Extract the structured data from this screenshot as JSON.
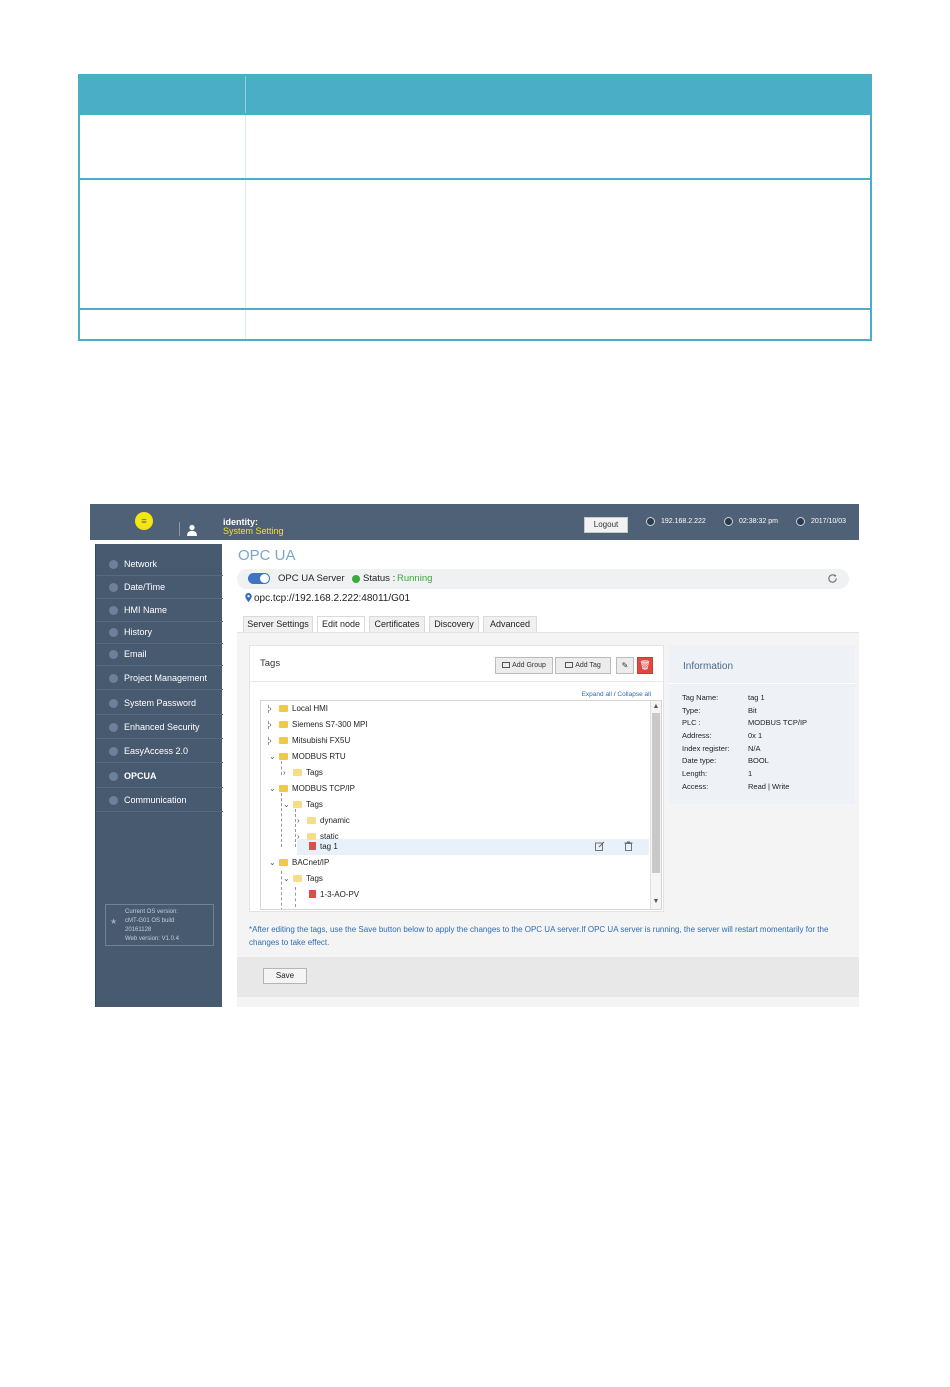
{
  "topbar": {
    "menu_icon": "menu-icon",
    "user_icon": "user-icon",
    "identity_label": "identity:",
    "role": "System Setting",
    "logout_label": "Logout",
    "ip": "192.168.2.222",
    "time": "02:38:32 pm",
    "date": "2017/10/03"
  },
  "sidebar": {
    "items": [
      {
        "label": "Network",
        "icon": "network-icon"
      },
      {
        "label": "Date/Time",
        "icon": "clock-icon"
      },
      {
        "label": "HMI Name",
        "icon": "pencil-icon"
      },
      {
        "label": "History",
        "icon": "history-icon"
      },
      {
        "label": "Email",
        "icon": "email-icon"
      },
      {
        "label": "Project Management",
        "icon": "project-icon"
      },
      {
        "label": "System Password",
        "icon": "lock-icon"
      },
      {
        "label": "Enhanced Security",
        "icon": "security-icon"
      },
      {
        "label": "EasyAccess 2.0",
        "icon": "easyaccess-icon"
      },
      {
        "label": "OPCUA",
        "icon": "opcua-icon"
      },
      {
        "label": "Communication",
        "icon": "communication-icon"
      }
    ],
    "active_index": 9,
    "version": {
      "line1": "Current OS version:",
      "line2": "cMT-G01 OS build",
      "line3": "20161128",
      "line4": "Web version: V1.0.4"
    }
  },
  "main": {
    "title": "OPC UA",
    "server_label": "OPC UA Server",
    "status_label": "Status :",
    "status_value": "Running",
    "url": "opc.tcp://192.168.2.222:48011/G01",
    "tabs": [
      {
        "label": "Server Settings"
      },
      {
        "label": "Edit node"
      },
      {
        "label": "Certificates"
      },
      {
        "label": "Discovery"
      },
      {
        "label": "Advanced"
      }
    ],
    "active_tab": 1
  },
  "tags_panel": {
    "title": "Tags",
    "add_group_label": "Add Group",
    "add_tag_label": "Add Tag",
    "expand_all": "Expand all",
    "separator": "/",
    "collapse_all": "Collapse all",
    "tree": [
      {
        "label": "Local HMI",
        "chev": "›",
        "type": "folder"
      },
      {
        "label": "Siemens S7-300 MPI",
        "chev": "›",
        "type": "folder"
      },
      {
        "label": "Mitsubishi FX5U",
        "chev": "›",
        "type": "folder"
      },
      {
        "label": "MODBUS RTU",
        "chev": "⌄",
        "type": "folder"
      },
      {
        "label": "Tags",
        "chev": "›",
        "type": "folder-light"
      },
      {
        "label": "MODBUS TCP/IP",
        "chev": "⌄",
        "type": "folder"
      },
      {
        "label": "Tags",
        "chev": "⌄",
        "type": "folder-light"
      },
      {
        "label": "dynamic",
        "chev": "›",
        "type": "folder-light"
      },
      {
        "label": "static",
        "chev": "›",
        "type": "folder-light"
      },
      {
        "label": "tag 1",
        "chev": "",
        "type": "tag"
      },
      {
        "label": "BACnet/IP",
        "chev": "⌄",
        "type": "folder"
      },
      {
        "label": "Tags",
        "chev": "⌄",
        "type": "folder-light"
      },
      {
        "label": "1-3-AO-PV",
        "chev": "",
        "type": "tag"
      }
    ]
  },
  "info_panel": {
    "title": "Information",
    "rows": [
      {
        "key": "Tag Name:",
        "value": "tag 1"
      },
      {
        "key": "Type:",
        "value": "Bit"
      },
      {
        "key": "PLC :",
        "value": "MODBUS TCP/IP"
      },
      {
        "key": "Address:",
        "value": "0x 1"
      },
      {
        "key": "Index register:",
        "value": "N/A"
      },
      {
        "key": "Date type:",
        "value": "BOOL"
      },
      {
        "key": "Length:",
        "value": "1"
      },
      {
        "key": "Access:",
        "value": "Read | Write"
      }
    ]
  },
  "note": "*After editing the tags, use the Save button below to apply the changes to the OPC UA server.If OPC UA server is running, the server will restart momentarily for the changes to take effect.",
  "save_label": "Save",
  "colors": {
    "table_accent": "#4aaec6",
    "topbar": "#4f6177",
    "sidebar": "#485a70",
    "menu_button": "#f5e612",
    "status_running": "#3aaa3a",
    "link": "#2f6db5",
    "delete": "#e5453f"
  }
}
